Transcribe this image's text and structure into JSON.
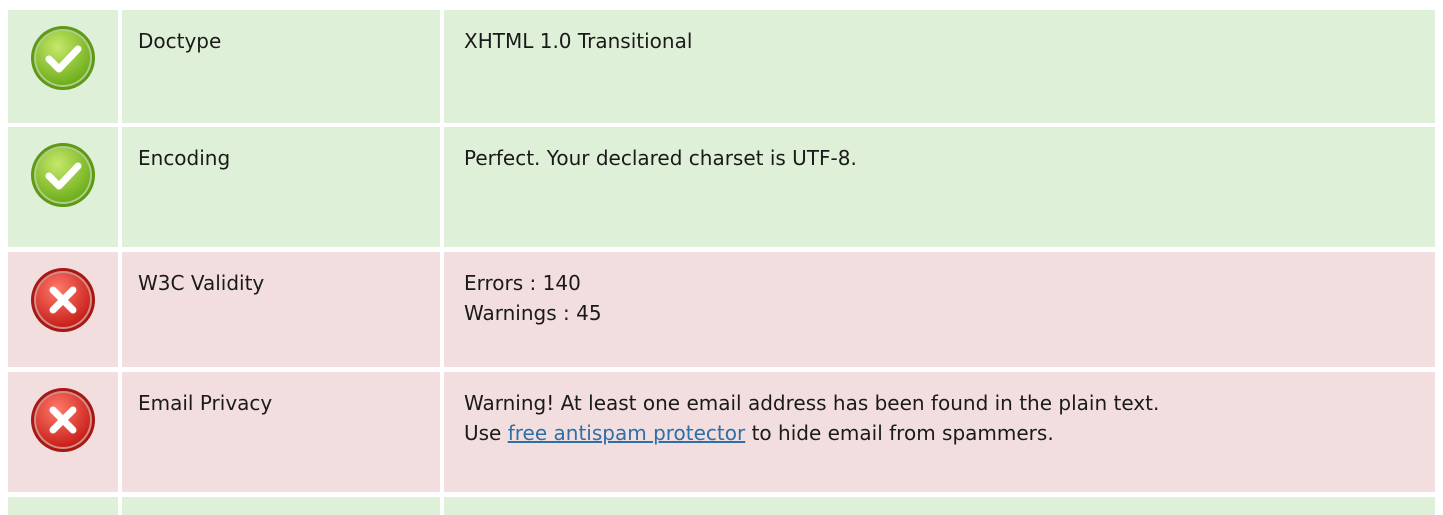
{
  "rows": [
    {
      "status": "pass",
      "icon": "check-circle-icon",
      "label": "Doctype",
      "lines": [
        "XHTML 1.0 Transitional"
      ]
    },
    {
      "status": "pass",
      "icon": "check-circle-icon",
      "label": "Encoding",
      "lines": [
        "Perfect. Your declared charset is UTF-8."
      ]
    },
    {
      "status": "fail",
      "icon": "error-circle-icon",
      "label": "W3C Validity",
      "lines": [
        "Errors : 140",
        "Warnings : 45"
      ]
    },
    {
      "status": "fail",
      "icon": "error-circle-icon",
      "label": "Email Privacy",
      "line1": "Warning! At least one email address has been found in the plain text.",
      "line2_pre": "Use ",
      "link": "free antispam protector",
      "line2_post": " to hide email from spammers."
    },
    {
      "status": "pass"
    }
  ],
  "colors": {
    "pass_bg": "#dff0d8",
    "fail_bg": "#f2dede",
    "pass_icon": "#8dc63f",
    "fail_icon": "#e0322c",
    "link": "#2f6ea6"
  }
}
